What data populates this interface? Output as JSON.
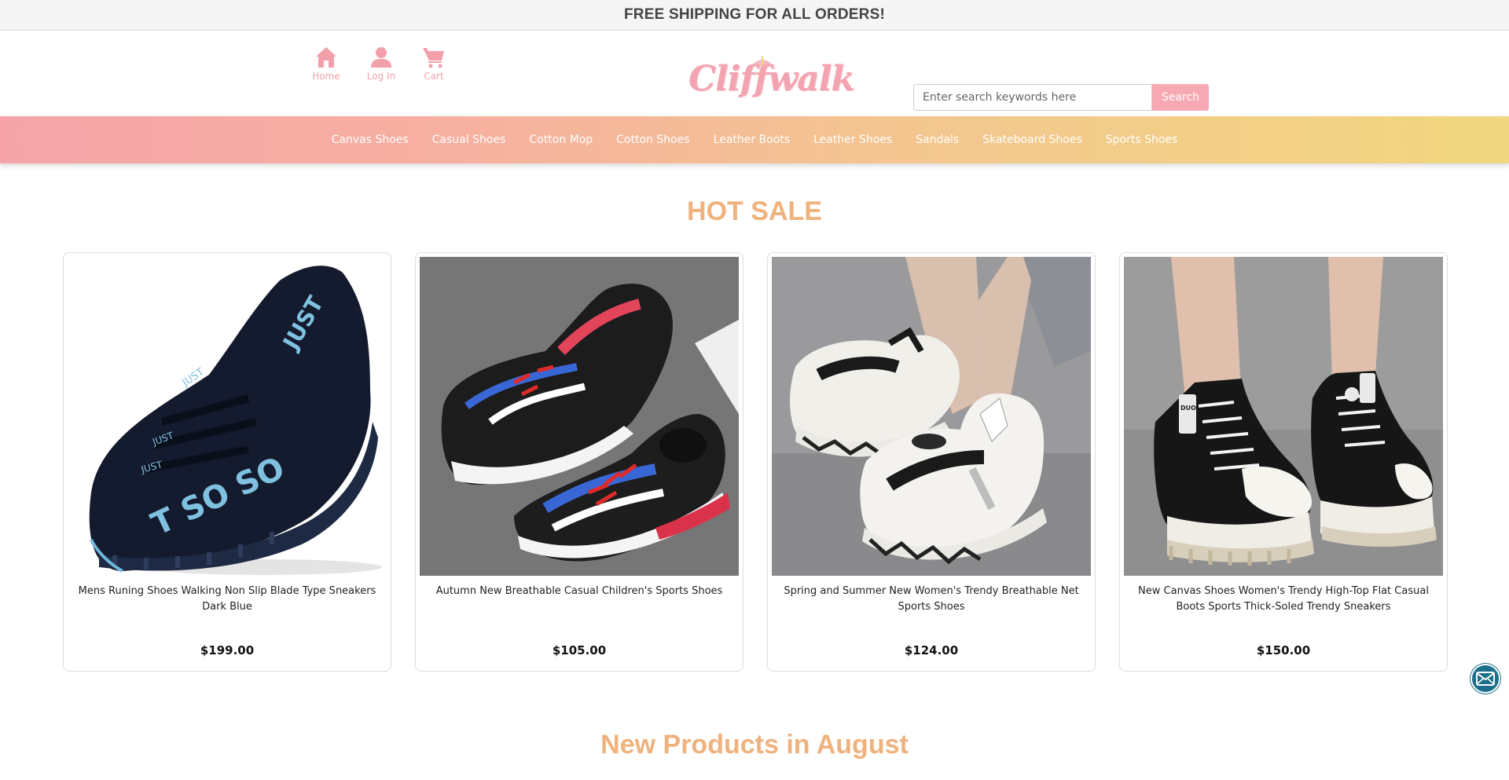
{
  "announcement": "FREE SHIPPING FOR ALL ORDERS!",
  "quicklinks": [
    {
      "label": "Home",
      "icon": "home-icon"
    },
    {
      "label": "Log In",
      "icon": "user-icon"
    },
    {
      "label": "Cart",
      "icon": "cart-icon"
    }
  ],
  "logo": {
    "text": "Cliffwalk"
  },
  "search": {
    "placeholder": "Enter search keywords here",
    "button_label": "Search"
  },
  "categories": [
    "Canvas Shoes",
    "Casual Shoes",
    "Cotton Mop",
    "Cotton Shoes",
    "Leather Boots",
    "Leather Shoes",
    "Sandals",
    "Skateboard Shoes",
    "Sports Shoes"
  ],
  "hot_sale": {
    "title": "HOT SALE",
    "products": [
      {
        "name": "Mens Runing Shoes Walking Non Slip Blade Type Sneakers Dark Blue",
        "price": "$199.00"
      },
      {
        "name": "Autumn New Breathable Casual Children's Sports Shoes",
        "price": "$105.00"
      },
      {
        "name": "Spring and Summer New Women's Trendy Breathable Net Sports Shoes",
        "price": "$124.00"
      },
      {
        "name": "New Canvas Shoes Women's Trendy High-Top Flat Casual Boots Sports Thick-Soled Trendy Sneakers",
        "price": "$150.00"
      }
    ]
  },
  "new_products": {
    "title": "New Products in August"
  },
  "colors": {
    "accent_pink": "#f7a9b3",
    "title_orange": "#efb27d",
    "nav_gradient_start": "#f5a3a8",
    "nav_gradient_end": "#f1d77f",
    "mail_button": "#1b6f8a"
  }
}
